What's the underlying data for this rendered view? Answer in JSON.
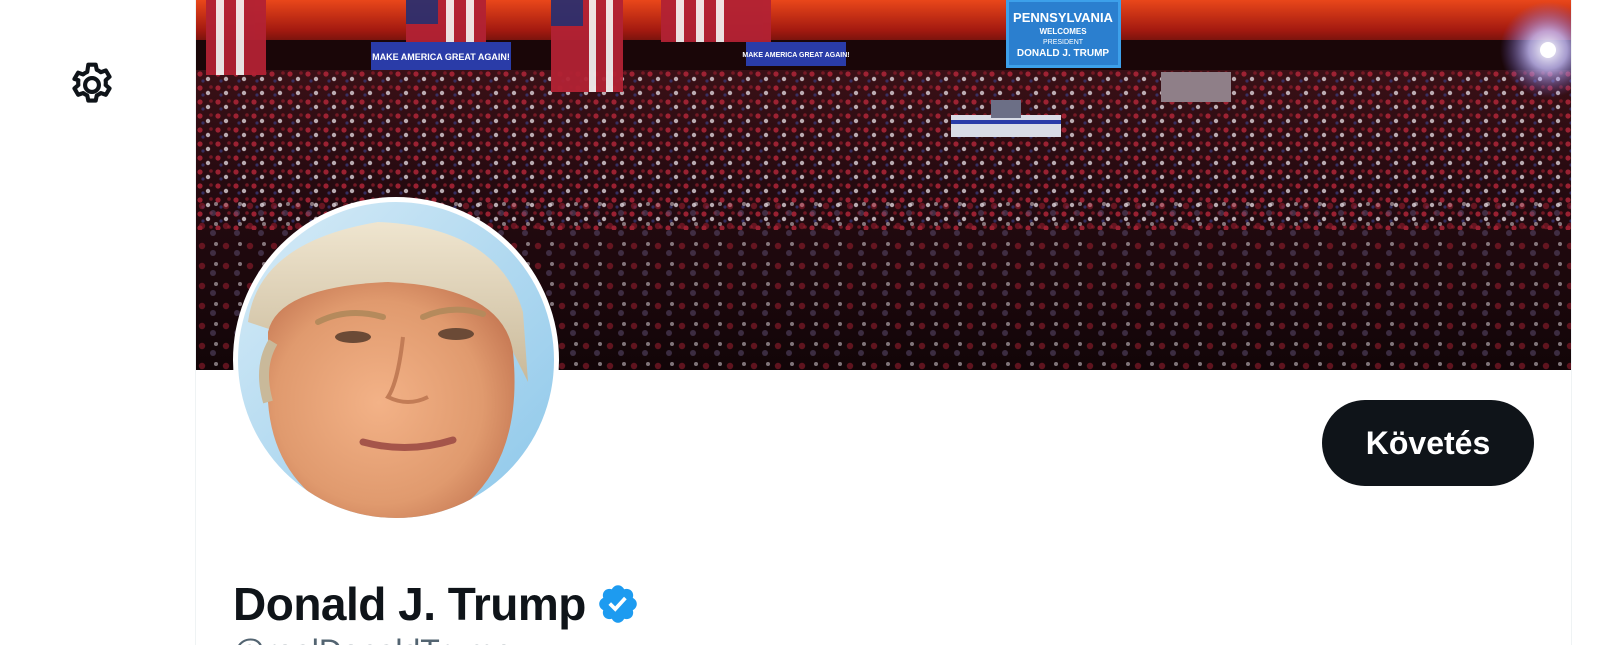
{
  "sidebar": {
    "settings_icon": "gear-icon"
  },
  "banner": {
    "sign_main": "MAKE AMERICA GREAT AGAIN!",
    "sign_secondary": "MAKE AMERICA GREAT AGAIN!",
    "screen_lines": [
      "PENNSYLVANIA",
      "WELCOMES",
      "PRESIDENT",
      "DONALD J. TRUMP"
    ]
  },
  "profile": {
    "display_name": "Donald J. Trump",
    "handle": "@realDonaldTrump",
    "verified_icon": "verified-badge-icon",
    "follow_label": "Követés"
  },
  "colors": {
    "follow_bg": "#0f1419",
    "verified": "#1d9bf0",
    "text_primary": "#0f1419",
    "text_secondary": "#536471"
  }
}
